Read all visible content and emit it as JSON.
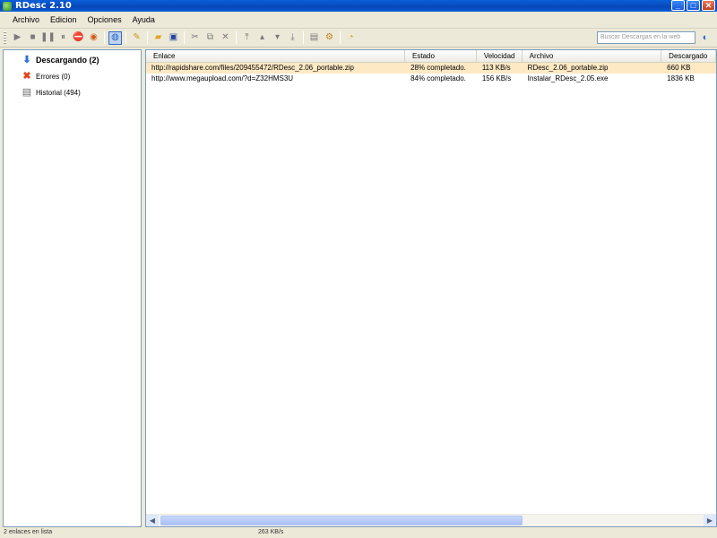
{
  "window": {
    "title": "RDesc 2.10"
  },
  "menu": {
    "items": [
      "Archivo",
      "Edicion",
      "Opciones",
      "Ayuda"
    ]
  },
  "toolbar": {
    "search_placeholder": "Buscar Descargas en la web",
    "icons": [
      "play-icon",
      "stop-icon",
      "pause-icon",
      "pause-all-icon",
      "stop-red-icon",
      "globe-red-icon",
      "clipboard-monitor-icon",
      "add-link-icon",
      "open-folder-icon",
      "save-icon",
      "cut-icon",
      "copy-icon",
      "delete-icon",
      "move-top-icon",
      "move-up-icon",
      "move-down-icon",
      "move-bottom-icon",
      "properties-icon",
      "options-icon",
      "timer-icon"
    ]
  },
  "sidebar": {
    "items": [
      {
        "label": "Descargando (2)",
        "icon": "download-arrow-icon",
        "selected": true
      },
      {
        "label": "Errores (0)",
        "icon": "error-x-icon"
      },
      {
        "label": "Historial (494)",
        "icon": "history-icon"
      }
    ]
  },
  "table": {
    "columns": [
      "Enlace",
      "Estado",
      "Velocidad",
      "Archivo",
      "Descargado"
    ],
    "rows": [
      [
        "http://rapidshare.com/files/209455472/RDesc_2.06_portable.zip",
        "28% completado.",
        "113 KB/s",
        "RDesc_2.06_portable.zip",
        "660 KB"
      ],
      [
        "http://www.megaupload.com/?d=Z32HMS3U",
        "84% completado.",
        "156 KB/s",
        "Instalar_RDesc_2.05.exe",
        "1836 KB"
      ]
    ]
  },
  "status": {
    "left": "2 enlaces en lista",
    "speed": "263 KB/s"
  }
}
